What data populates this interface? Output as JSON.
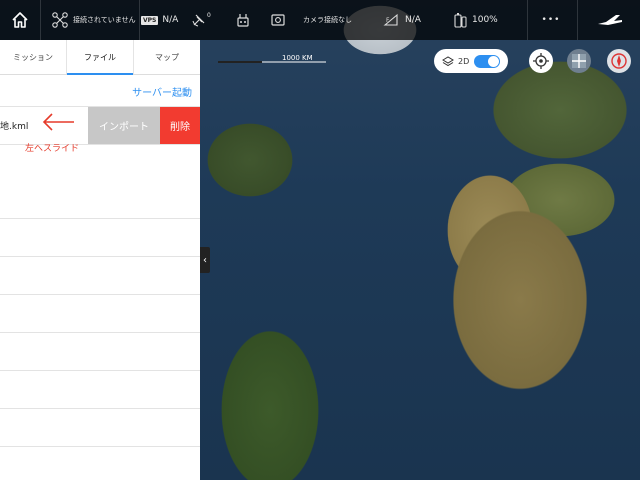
{
  "topbar": {
    "connection_status": "接続されていません",
    "vision_value": "N/A",
    "signal_count": "0",
    "camera_status": "カメラ接続なし",
    "gps_value": "N/A",
    "battery": "100%",
    "more": "•••"
  },
  "panel": {
    "tabs": [
      "ミッション",
      "ファイル",
      "マップ"
    ],
    "active_tab": "ファイル",
    "server_start": "サーバー起動",
    "file_name": "地.kml",
    "import_label": "インポート",
    "delete_label": "削除",
    "swipe_hint": "左へスライド"
  },
  "map": {
    "scale_label": "1000 KM",
    "mode_2d": "2D",
    "mode_2d_enabled": true,
    "collapse": "‹"
  },
  "colors": {
    "accent": "#2d8ff0",
    "delete": "#f23b30",
    "import": "#c7c7c7",
    "hint": "#e53a2a"
  }
}
